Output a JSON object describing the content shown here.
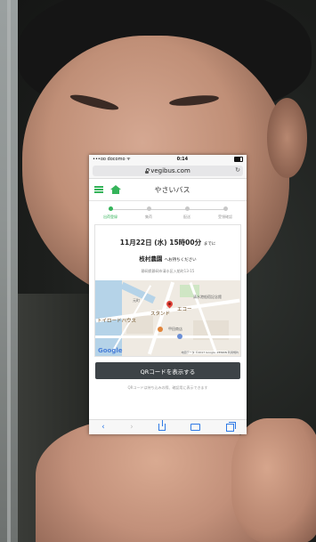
{
  "status_bar": {
    "carrier": "•••oo docomo ᯤ",
    "time": "0:14",
    "battery": "battery-icon"
  },
  "browser": {
    "url": "vegibus.com",
    "lock": "lock-icon",
    "reload": "↻"
  },
  "app_header": {
    "menu_icon": "hamburger-icon",
    "home_icon": "home-icon",
    "title": "やさいバス"
  },
  "steps": [
    {
      "label": "出荷登録",
      "active": true
    },
    {
      "label": "集荷",
      "active": false
    },
    {
      "label": "配送",
      "active": false
    },
    {
      "label": "受領確認",
      "active": false
    }
  ],
  "pickup": {
    "date": "11月22日 (水)",
    "time": "15時00分",
    "deadline_suffix": "までに",
    "farm_name": "枝村農園",
    "wait_text": "へお持ちください",
    "address": "静岡県静岡市清水区入船町13-15"
  },
  "map": {
    "label_1": "スタンド",
    "label_2": "エコー",
    "label_3": "トイロードハウス",
    "label_4": "甲田商店",
    "label_5": "清水港船宿記念館",
    "label_6": "元町",
    "google": "Google",
    "copyright": "地図データ ©2017 Google, ZENRIN  利用規約"
  },
  "actions": {
    "qr_button": "QRコードを表示する",
    "qr_note": "QRコードは持ち込みの際、確認用に表示できます"
  },
  "toolbar": {
    "back": "‹",
    "forward": "›"
  }
}
